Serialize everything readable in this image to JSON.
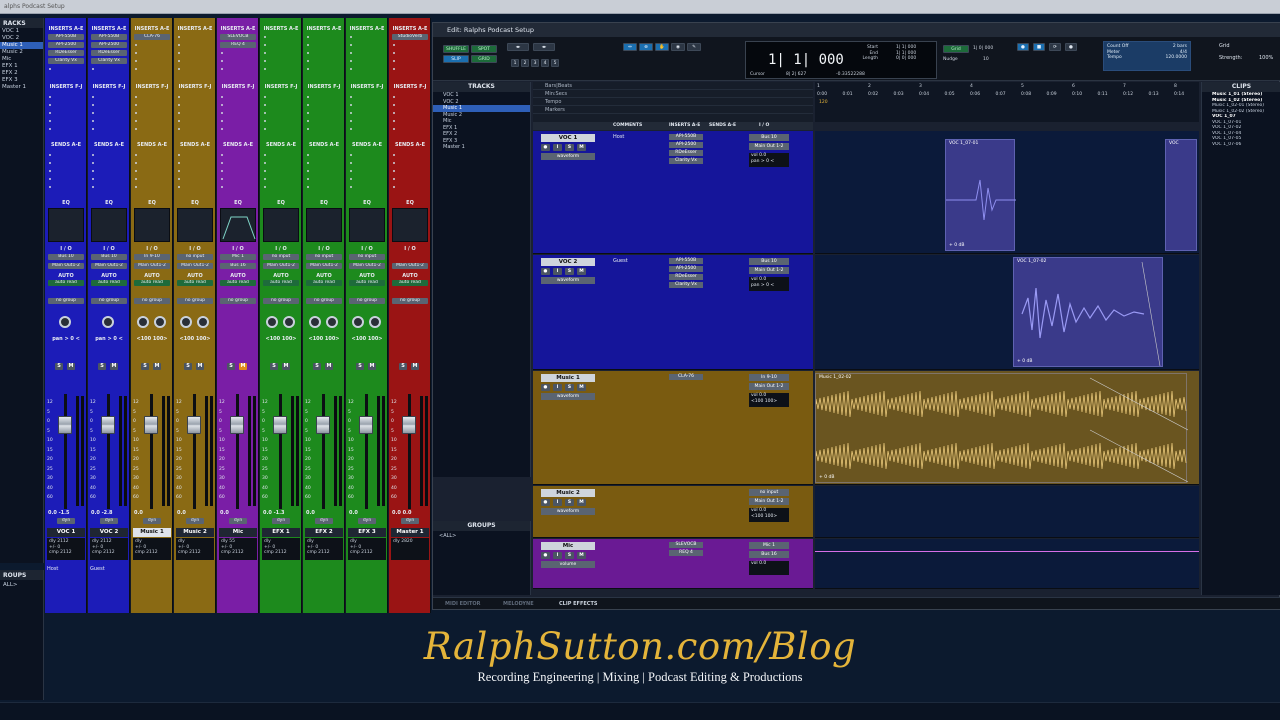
{
  "window_title": "alphs Podcast Setup",
  "left_panel": {
    "tracks_header": "RACKS",
    "tracks": [
      "VOC 1",
      "VOC 2",
      "Music 1",
      "Music 2",
      "Mic",
      "EFX 1",
      "EFX 2",
      "EFX 3",
      "Master 1"
    ],
    "selected_index": 2,
    "groups_header": "ROUPS",
    "groups_item": "ALL>"
  },
  "mixer": {
    "labels": {
      "inserts_ae": "INSERTS A-E",
      "inserts_fj": "INSERTS F-J",
      "sends_ae": "SENDS A-E",
      "eq": "EQ",
      "io": "I / O",
      "auto": "AUTO",
      "no_group": "no group",
      "dyn": "dyn"
    },
    "scale": [
      "12",
      "5",
      "0",
      "5",
      "10",
      "15",
      "20",
      "25",
      "30",
      "40",
      "60"
    ],
    "strips": [
      {
        "name": "VOC 1",
        "color": "#1c1cb8",
        "inserts": [
          "API-550B",
          "API-2500",
          "RDeEsser",
          "Clarity Vx"
        ],
        "io_in": "Bus 10",
        "io_out": "Main Out1-2",
        "mode": "auto read",
        "pan": "pan  > 0 <",
        "values": "0.0   -1.5",
        "readout": [
          "dly     2112",
          "+/-         0",
          "cmp   2112"
        ],
        "comment": "Host",
        "m_on": false
      },
      {
        "name": "VOC 2",
        "color": "#1c1cb8",
        "inserts": [
          "API-550B",
          "API-2500",
          "RDeEsser",
          "Clarity Vx"
        ],
        "io_in": "Bus 10",
        "io_out": "Main Out1-2",
        "mode": "auto read",
        "pan": "pan  > 0 <",
        "values": "0.0   -2.8",
        "readout": [
          "dly     2112",
          "+/-         0",
          "cmp   2112"
        ],
        "comment": "Guest",
        "m_on": false
      },
      {
        "name": "Music 1",
        "color": "#8a6a14",
        "inserts": [
          "CLA-76"
        ],
        "io_in": "In 9-10",
        "io_out": "Main Out1-2",
        "mode": "auto read",
        "pan": "<100  100>",
        "values": "0.0",
        "readout": [
          "dly",
          "+/-         0",
          "cmp   2112"
        ],
        "comment": "",
        "m_on": false,
        "selected": true
      },
      {
        "name": "Music 2",
        "color": "#8a6a14",
        "inserts": [],
        "io_in": "no input",
        "io_out": "Main Out1-2",
        "mode": "auto read",
        "pan": "<100  100>",
        "values": "0.0",
        "readout": [
          "dly",
          "+/-         0",
          "cmp   2112"
        ],
        "comment": "",
        "m_on": false
      },
      {
        "name": "Mic",
        "color": "#7a1ea6",
        "inserts": [
          "SLEVOCB",
          "REQ 4"
        ],
        "io_in": "Mic 1",
        "io_out": "Bus 16",
        "mode": "auto read",
        "pan": "",
        "values": "0.0",
        "readout": [
          "dly        55",
          "+/-         0",
          "cmp   2112"
        ],
        "comment": "",
        "m_on": true
      },
      {
        "name": "EFX 1",
        "color": "#1d8a1d",
        "inserts": [],
        "io_in": "no input",
        "io_out": "Main Out1-2",
        "mode": "auto read",
        "pan": "<100  100>",
        "values": "0.0   -1.3",
        "readout": [
          "dly",
          "+/-         0",
          "cmp   2112"
        ],
        "comment": "",
        "m_on": false
      },
      {
        "name": "EFX 2",
        "color": "#1d8a1d",
        "inserts": [],
        "io_in": "no input",
        "io_out": "Main Out1-2",
        "mode": "auto read",
        "pan": "<100  100>",
        "values": "0.0",
        "readout": [
          "dly",
          "+/-         0",
          "cmp   2112"
        ],
        "comment": "",
        "m_on": false
      },
      {
        "name": "EFX 3",
        "color": "#1d8a1d",
        "inserts": [],
        "io_in": "no input",
        "io_out": "Main Out1-2",
        "mode": "auto read",
        "pan": "<100  100>",
        "values": "0.0",
        "readout": [
          "dly",
          "+/-         0",
          "cmp   2112"
        ],
        "comment": "",
        "m_on": false
      },
      {
        "name": "Master 1",
        "color": "#9a1414",
        "inserts": [
          "StudioVerb"
        ],
        "io_in": "",
        "io_out": "Main Out1-2",
        "mode": "auto read",
        "pan": "",
        "values": "0.0   0.0",
        "readout": [
          "dly     2820"
        ],
        "comment": "",
        "m_on": false
      }
    ]
  },
  "edit": {
    "title": "Edit: Ralphs Podcast Setup",
    "toolbar": {
      "shuffle": "SHUFFLE",
      "spot": "SPOT",
      "slip": "SLIP",
      "grid": "GRID",
      "zoom_presets": [
        "1",
        "2",
        "3",
        "4",
        "5"
      ],
      "main_counter": "1| 1| 000",
      "start_lbl": "Start",
      "end_lbl": "End",
      "length_lbl": "Length",
      "start": "1| 1| 000",
      "end": "1| 1| 000",
      "length": "0| 0| 000",
      "cursor_lbl": "Cursor",
      "cursor": "8| 2| 627",
      "cursor_extra": "-0.33522288",
      "grid_lbl": "Grid",
      "grid_val": "1| 0| 000",
      "nudge_lbl": "Nudge",
      "nudge_val": "10",
      "count_off": "Count Off",
      "meter_lbl": "Meter",
      "tempo_lbl": "Tempo",
      "bars": "2 bars",
      "meter": "4/4",
      "tempo": "120.0000",
      "grid2": "Grid",
      "strength": "Strength:",
      "strength_val": "100%"
    },
    "tracks_header": "TRACKS",
    "tracks": [
      "VOC 1",
      "VOC 2",
      "Music 1",
      "Music 2",
      "Mic",
      "EFX 1",
      "EFX 2",
      "EFX 3",
      "Master 1"
    ],
    "selected_track": 2,
    "groups_header": "GROUPS",
    "groups_item": "<ALL>",
    "rulers": [
      "Bars|Beats",
      "Min:Secs",
      "Tempo",
      "Markers"
    ],
    "tempo_value": "120",
    "bar_numbers": [
      "1",
      "2",
      "3",
      "4",
      "5",
      "6",
      "7",
      "8"
    ],
    "time_ticks": [
      "0:00",
      "0:01",
      "0:02",
      "0:03",
      "0:04",
      "0:05",
      "0:06",
      "0:07",
      "0:08",
      "0:09",
      "0:10",
      "0:11",
      "0:12",
      "0:13",
      "0:14"
    ],
    "col_headers": [
      "COMMENTS",
      "INSERTS A-E",
      "SENDS A-E",
      "I / O"
    ],
    "tracks_detail": [
      {
        "name": "VOC 1",
        "comment": "Host",
        "view": "waveform",
        "inserts": [
          "API-550B",
          "API-2500",
          "RDeEsser",
          "Clarity Vx"
        ],
        "io_in": "Bus 10",
        "io_out": "Main Out 1-2",
        "vol": "vol        0.0",
        "pan": "pan     > 0 <",
        "color": "#15159a",
        "lane": "#0b1a3a"
      },
      {
        "name": "VOC 2",
        "comment": "Guest",
        "view": "waveform",
        "inserts": [
          "API-550B",
          "API-2500",
          "RDeEsser",
          "Clarity Vx"
        ],
        "io_in": "Bus 10",
        "io_out": "Main Out 1-2",
        "vol": "vol        0.0",
        "pan": "pan     > 0 <",
        "color": "#15159a",
        "lane": "#0b1a3a"
      },
      {
        "name": "Music 1",
        "comment": "",
        "view": "waveform",
        "inserts": [
          "CLA-76"
        ],
        "io_in": "In 9-10",
        "io_out": "Main Out 1-2",
        "vol": "vol        0.0",
        "pan": "<100   100>",
        "color": "#7a5b10",
        "lane": "#6a5520"
      },
      {
        "name": "Music 2",
        "comment": "",
        "view": "waveform",
        "inserts": [],
        "io_in": "no input",
        "io_out": "Main Out 1-2",
        "vol": "vol        0.0",
        "pan": "<100   100>",
        "color": "#7a5b10",
        "lane": "#0b1a3a"
      },
      {
        "name": "Mic",
        "comment": "",
        "view": "volume",
        "inserts": [
          "SLEVOCB",
          "REQ 4"
        ],
        "io_in": "Mic 1",
        "io_out": "Bus 16",
        "vol": "vol        0.0",
        "pan": "",
        "color": "#6a1a94",
        "lane": "#0b1a3a"
      }
    ],
    "clips": {
      "voc1_a": "VOC 1_07-01",
      "voc1_b": "VOC",
      "voc2": "VOC 1_07-02",
      "music1": "Music 1_02-02",
      "db": "+ 0 dB"
    },
    "clips_header": "CLIPS",
    "clip_list": [
      "Music 1_01 (Stereo)",
      "Music 1_02 (Stereo)",
      "Music 1_02-01 (Stereo)",
      "Music 1_02-02 (Stereo)",
      "VOC 1_07",
      "VOC 1_07-01",
      "VOC 1_07-02",
      "VOC 1_07-04",
      "VOC 1_07-05",
      "VOC 1_07-06"
    ],
    "bottom_tabs": [
      "MIDI EDITOR",
      "MELODYNE",
      "CLIP EFFECTS"
    ]
  },
  "brand": {
    "title": "RalphSutton.com/Blog",
    "subtitle": "Recording Engineering | Mixing | Podcast Editing & Productions"
  },
  "colors": {
    "brand": "#e4b43a",
    "voc": "#15159a",
    "music": "#7a5b10",
    "mic": "#6a1a94",
    "efx": "#1d8a1d",
    "master": "#9a1414",
    "selected": "#2e5fb8"
  }
}
